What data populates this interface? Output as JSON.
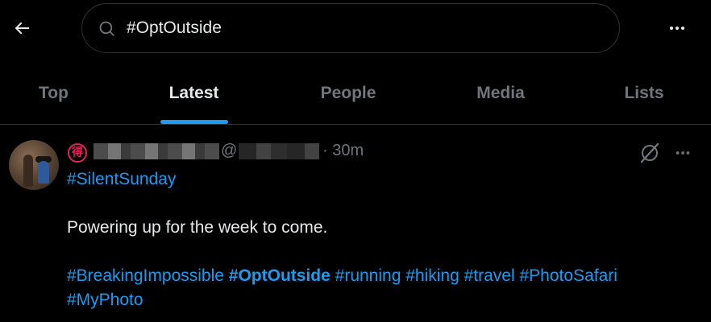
{
  "header": {
    "search": {
      "value": "#OptOutside",
      "placeholder": "Search"
    }
  },
  "tabs": [
    {
      "label": "Top",
      "active": false
    },
    {
      "label": "Latest",
      "active": true
    },
    {
      "label": "People",
      "active": false
    },
    {
      "label": "Media",
      "active": false
    },
    {
      "label": "Lists",
      "active": false
    }
  ],
  "tweet": {
    "badge": "得",
    "at_sign": "@",
    "timestamp": "· 30m",
    "hashtags_line1": [
      "#SilentSunday"
    ],
    "text": "Powering up for the week to come.",
    "hashtags_line3": [
      {
        "text": "#BreakingImpossible",
        "bold": false
      },
      {
        "text": "#OptOutside",
        "bold": true
      },
      {
        "text": "#running",
        "bold": false
      },
      {
        "text": "#hiking",
        "bold": false
      },
      {
        "text": "#travel",
        "bold": false
      },
      {
        "text": "#PhotoSafari",
        "bold": false
      }
    ],
    "hashtags_line4": [
      "#MyPhoto"
    ]
  },
  "colors": {
    "accent": "#1d9bf0",
    "background": "#000000",
    "text_primary": "#e7e9ea",
    "text_secondary": "#71767b",
    "border": "#2f3336"
  },
  "icons": {
    "back": "arrow-left-icon",
    "search": "search-icon",
    "more": "more-horizontal-icon",
    "grok": "grok-icon"
  }
}
